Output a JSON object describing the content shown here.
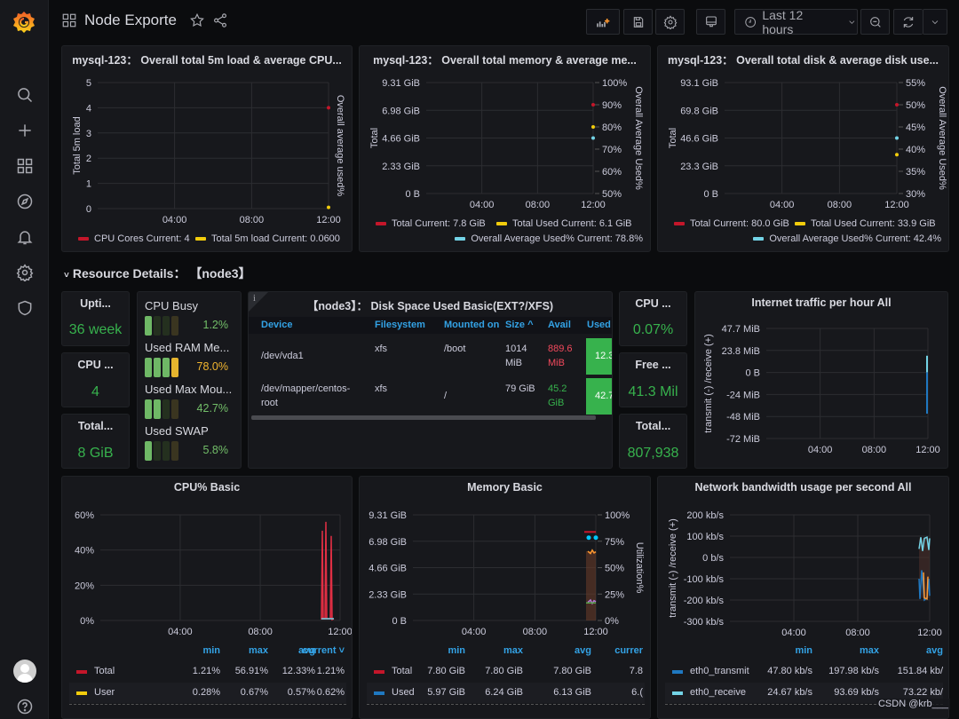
{
  "app": {
    "title": "Node Exporte"
  },
  "sidebar": {
    "items": [
      {
        "name": "search",
        "icon": "search-icon"
      },
      {
        "name": "create",
        "icon": "plus-icon"
      },
      {
        "name": "dashboards",
        "icon": "grid-icon"
      },
      {
        "name": "explore",
        "icon": "compass-icon"
      },
      {
        "name": "alerting",
        "icon": "bell-icon"
      },
      {
        "name": "configuration",
        "icon": "gear-icon"
      },
      {
        "name": "server-admin",
        "icon": "shield-icon"
      }
    ],
    "bottom": [
      {
        "name": "profile",
        "icon": "avatar"
      },
      {
        "name": "help",
        "icon": "help-icon"
      }
    ]
  },
  "toolbar": {
    "time_range": "Last 12 hours",
    "buttons": [
      "add-panel",
      "save",
      "settings",
      "tv-mode",
      "time-picker",
      "zoom-out",
      "refresh",
      "refresh-interval"
    ]
  },
  "panels_top": [
    {
      "title": "mysql-123： Overall total 5m load & average CPU...",
      "ylabel": "Total 5m load",
      "y2label": "Overall average used%",
      "yticks": [
        "5",
        "4",
        "3",
        "2",
        "1",
        "0"
      ],
      "y2ticks": [],
      "xticks": [
        "04:00",
        "08:00",
        "12:00"
      ],
      "legend": [
        {
          "label": "CPU Cores  Current: 4",
          "color": "#c4162a"
        },
        {
          "label": "Total 5m load  Current: 0.0600",
          "color": "#f2cc0c"
        }
      ]
    },
    {
      "title": "mysql-123： Overall total memory & average me...",
      "ylabel": "Total",
      "y2label": "Overall Average Used%",
      "yticks": [
        "9.31 GiB",
        "6.98 GiB",
        "4.66 GiB",
        "2.33 GiB",
        "0 B"
      ],
      "y2ticks": [
        "100%",
        "90%",
        "80%",
        "70%",
        "60%",
        "50%"
      ],
      "xticks": [
        "04:00",
        "08:00",
        "12:00"
      ],
      "legend": [
        {
          "label": "Total  Current: 7.8 GiB",
          "color": "#c4162a"
        },
        {
          "label": "Total Used  Current: 6.1 GiB",
          "color": "#f2cc0c"
        },
        {
          "label": "Overall Average Used%  Current: 78.8%",
          "color": "#73d3e6"
        }
      ]
    },
    {
      "title": "mysql-123： Overall total disk & average disk use...",
      "ylabel": "Total",
      "y2label": "Overall Average Used%",
      "yticks": [
        "93.1 GiB",
        "69.8 GiB",
        "46.6 GiB",
        "23.3 GiB",
        "0 B"
      ],
      "y2ticks": [
        "55%",
        "50%",
        "45%",
        "40%",
        "35%",
        "30%"
      ],
      "xticks": [
        "04:00",
        "08:00",
        "12:00"
      ],
      "legend": [
        {
          "label": "Total  Current: 80.0 GiB",
          "color": "#c4162a"
        },
        {
          "label": "Total Used  Current: 33.9 GiB",
          "color": "#f2cc0c"
        },
        {
          "label": "Overall Average Used%  Current: 42.4%",
          "color": "#73d3e6"
        }
      ]
    }
  ],
  "row": {
    "title": "Resource Details： 【node3】"
  },
  "stats_left": [
    {
      "title": "Upti...",
      "value": "36 week"
    },
    {
      "title": "CPU ...",
      "value": "4"
    },
    {
      "title": "Total...",
      "value": "8 GiB"
    }
  ],
  "gauges": [
    {
      "label": "CPU Busy",
      "value": "1.2%",
      "percent": 1.2,
      "color": "#73bf69"
    },
    {
      "label": "Used RAM Me...",
      "value": "78.0%",
      "percent": 78.0,
      "color": "#f2b62f"
    },
    {
      "label": "Used Max Mou...",
      "value": "42.7%",
      "percent": 42.7,
      "color": "#73bf69"
    },
    {
      "label": "Used SWAP",
      "value": "5.8%",
      "percent": 5.8,
      "color": "#73bf69"
    }
  ],
  "disk_table": {
    "title": "【node3】： Disk Space Used Basic(EXT?/XFS)",
    "columns": [
      "Device",
      "Filesystem",
      "Mounted on",
      "Size ^",
      "Avail",
      "Used"
    ],
    "rows": [
      {
        "device": "/dev/vda1",
        "fs": "xfs",
        "mount": "/boot",
        "size": "1014 MiB",
        "avail": "889.6 MiB",
        "avail_color": "#f2495c",
        "used": "12.3"
      },
      {
        "device": "/dev/mapper/centos-root",
        "fs": "xfs",
        "mount": "/",
        "size": "79 GiB",
        "avail": "45.2 GiB",
        "avail_color": "#37b24d",
        "used": "42.7"
      }
    ]
  },
  "stats_right": [
    {
      "title": "CPU ...",
      "value": "0.07%"
    },
    {
      "title": "Free ...",
      "value": "41.3 Mil"
    },
    {
      "title": "Total...",
      "value": "807,938"
    }
  ],
  "traffic": {
    "title": "Internet traffic per hour All",
    "ylabel": "transmit  (-)  /receive  (+)",
    "yticks": [
      "47.7 MiB",
      "23.8 MiB",
      "0 B",
      "-24 MiB",
      "-48 MiB",
      "-72 MiB"
    ],
    "xticks": [
      "04:00",
      "08:00",
      "12:00"
    ]
  },
  "cpu_basic": {
    "title": "CPU% Basic",
    "yticks": [
      "60%",
      "40%",
      "20%",
      "0%"
    ],
    "xticks": [
      "04:00",
      "08:00",
      "12:00"
    ],
    "legend_headers": [
      "min",
      "max",
      "avg",
      "current ˅"
    ],
    "legend_rows": [
      {
        "name": "Total",
        "color": "#c4162a",
        "values": [
          "1.21%",
          "56.91%",
          "12.33%",
          "1.21%"
        ]
      },
      {
        "name": "User",
        "color": "#f2cc0c",
        "values": [
          "0.28%",
          "0.67%",
          "0.57%",
          "0.62%"
        ]
      }
    ]
  },
  "mem_basic": {
    "title": "Memory Basic",
    "yticks": [
      "9.31 GiB",
      "6.98 GiB",
      "4.66 GiB",
      "2.33 GiB",
      "0 B"
    ],
    "y2ticks": [
      "100%",
      "75%",
      "50%",
      "25%",
      "0%"
    ],
    "y2label": "Utilization%",
    "xticks": [
      "04:00",
      "08:00",
      "12:00"
    ],
    "legend_headers": [
      "min",
      "max",
      "avg",
      "currer"
    ],
    "legend_rows": [
      {
        "name": "Total",
        "color": "#c4162a",
        "values": [
          "7.80 GiB",
          "7.80 GiB",
          "7.80 GiB",
          "7.8"
        ]
      },
      {
        "name": "Used",
        "color": "#1f78c1",
        "values": [
          "5.97 GiB",
          "6.24 GiB",
          "6.13 GiB",
          "6.("
        ]
      }
    ]
  },
  "net_basic": {
    "title": "Network bandwidth usage per second All",
    "ylabel": "transmit  (-)  /receive  (+)",
    "yticks": [
      "200 kb/s",
      "100 kb/s",
      "0 b/s",
      "-100 kb/s",
      "-200 kb/s",
      "-300 kb/s"
    ],
    "xticks": [
      "04:00",
      "08:00",
      "12:00"
    ],
    "legend_headers": [
      "min",
      "max",
      "avg"
    ],
    "legend_rows": [
      {
        "name": "eth0_transmit",
        "color": "#1f78c1",
        "values": [
          "47.80 kb/s",
          "197.98 kb/s",
          "151.84 kb/"
        ]
      },
      {
        "name": "eth0_receive",
        "color": "#73d3e6",
        "values": [
          "24.67 kb/s",
          "93.69 kb/s",
          "73.22 kb/"
        ]
      }
    ]
  },
  "watermark": "CSDN @krb___"
}
